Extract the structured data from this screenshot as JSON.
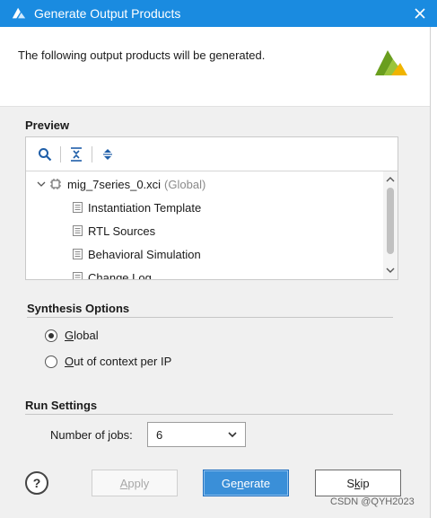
{
  "window": {
    "title": "Generate Output Products",
    "close_icon": "close-icon",
    "logo_icon": "vivado-logo-icon"
  },
  "header": {
    "message": "The following output products will be generated.",
    "logo_icon": "vivado-logo-icon"
  },
  "preview": {
    "title": "Preview",
    "toolbar_icons": [
      "search-icon",
      "collapse-all-icon",
      "expand-all-icon"
    ],
    "tree": {
      "root": {
        "label": "mig_7series_0.xci",
        "scope": "(Global)"
      },
      "children": [
        {
          "label": "Instantiation Template"
        },
        {
          "label": "RTL Sources"
        },
        {
          "label": "Behavioral Simulation"
        },
        {
          "label": "Change Log"
        }
      ]
    }
  },
  "synthesis": {
    "title": "Synthesis Options",
    "options": [
      {
        "mnemonic": "G",
        "rest": "lobal",
        "selected": true
      },
      {
        "mnemonic": "O",
        "rest": "ut of context per IP",
        "selected": false
      }
    ]
  },
  "run_settings": {
    "title": "Run Settings",
    "jobs_label": "Number of jobs:",
    "jobs_value": "6"
  },
  "buttons": {
    "help": "?",
    "apply": {
      "mnemonic": "A",
      "rest": "pply",
      "enabled": false
    },
    "generate": {
      "before": "Ge",
      "mnemonic": "n",
      "after": "erate"
    },
    "skip": {
      "before": "S",
      "mnemonic": "k",
      "after": "ip"
    }
  },
  "watermark": "CSDN @QYH2023",
  "colors": {
    "titlebar": "#1a8be0",
    "accent_button": "#3a8fd8",
    "dialog_bg": "#f0f0f0"
  }
}
